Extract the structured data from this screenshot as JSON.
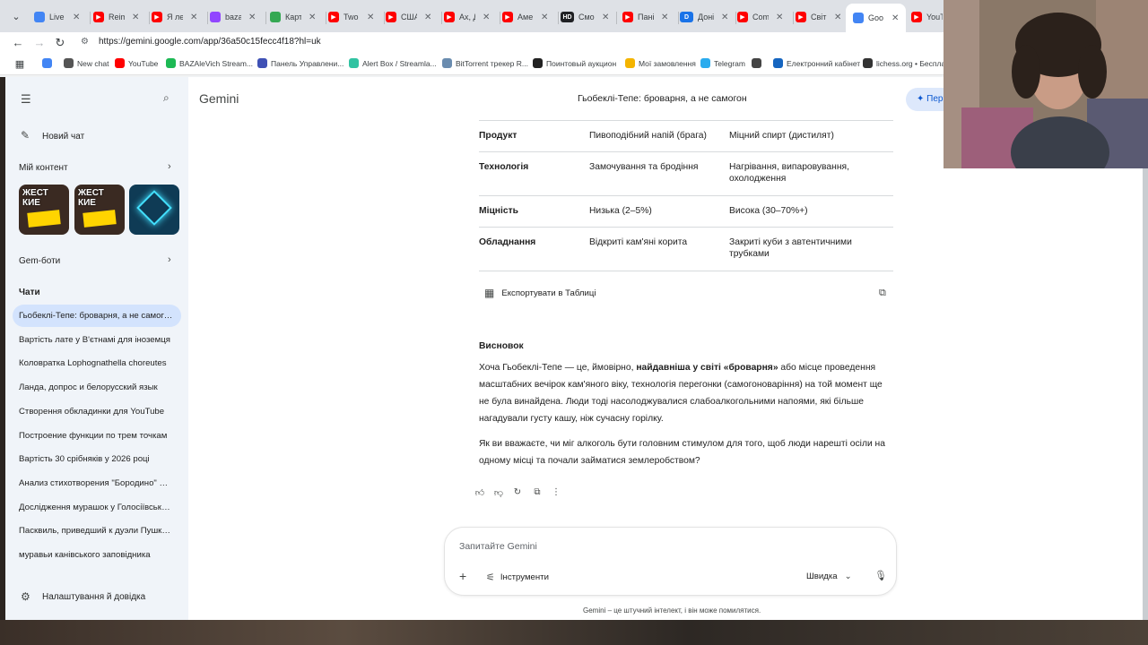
{
  "tabs": [
    {
      "title": "Live",
      "color": "#4285f4"
    },
    {
      "title": "Reim",
      "color": "#ff0000"
    },
    {
      "title": "Я ле",
      "color": "#ff0000"
    },
    {
      "title": "baza",
      "color": "#9146ff"
    },
    {
      "title": "Карт",
      "color": "#34a853"
    },
    {
      "title": "Two",
      "color": "#ff0000"
    },
    {
      "title": "США",
      "color": "#ff0000"
    },
    {
      "title": "Ах, Д",
      "color": "#ff0000"
    },
    {
      "title": "Аме",
      "color": "#ff0000"
    },
    {
      "title": "Смо",
      "color": "#202124",
      "badge": "HD"
    },
    {
      "title": "Пані",
      "color": "#ff0000"
    },
    {
      "title": "Доні",
      "color": "#1a73e8",
      "badge": "D"
    },
    {
      "title": "Com",
      "color": "#ff0000"
    },
    {
      "title": "Світ",
      "color": "#ff0000"
    },
    {
      "title": "Goo",
      "color": "#4285f4",
      "active": true
    },
    {
      "title": "YouT",
      "color": "#ff0000"
    }
  ],
  "address": {
    "url": "https://gemini.google.com/app/36a50c15fecc4f18?hl=uk"
  },
  "bookmarks": [
    {
      "label": "",
      "color": "#4285f4"
    },
    {
      "label": "New chat",
      "color": "#555555"
    },
    {
      "label": "YouTube",
      "color": "#ff0000"
    },
    {
      "label": "BAZAleVich Stream...",
      "color": "#1db954"
    },
    {
      "label": "Панель Управлени...",
      "color": "#3f51b5"
    },
    {
      "label": "Alert Box / Streamla...",
      "color": "#31c3a2"
    },
    {
      "label": "BitTorrent трекер R...",
      "color": "#6a8caf"
    },
    {
      "label": "Поинтовый аукцион",
      "color": "#222222"
    },
    {
      "label": "Мої замовлення",
      "color": "#f4b400"
    },
    {
      "label": "Telegram",
      "color": "#2aabee"
    },
    {
      "label": "",
      "color": "#444444"
    },
    {
      "label": "Електронний кабінет",
      "color": "#1565c0"
    },
    {
      "label": "lichess.org • Беспла...",
      "color": "#333333"
    }
  ],
  "sidebar": {
    "new_chat": "Новий чат",
    "my_content": "Мій контент",
    "gems": "Gem-боти",
    "chats_heading": "Чати",
    "settings": "Налаштування й довідка",
    "thumbs": [
      {
        "text": "ЖЕСТ КИЕ",
        "bg": "#3a2a22",
        "accent": "#ffd400"
      },
      {
        "text": "ЖЕСТ КИЕ",
        "bg": "#3a2a22",
        "accent": "#ffd400"
      },
      {
        "text": "",
        "bg": "#0f3b55",
        "accent": "#43e0ff"
      }
    ],
    "chats": [
      "Гьобеклі-Тепе: броварня, а не самогон",
      "Вартість лате у В'єтнамі для іноземця",
      "Коловратка Lophognathella choreutes",
      "Ланда, допрос и белорусский язык",
      "Створення обкладинки для YouTube",
      "Построение функции по трем точкам",
      "Вартість 30 срібняків у 2026 році",
      "Анализ стихотворения \"Бородино\" Лермонтова",
      "Дослідження мурашок у Голосіївському лісі",
      "Пасквиль, приведший к дуэли Пушкина",
      "муравьи канівського заповідника"
    ]
  },
  "header": {
    "brand": "Gemini",
    "chat_title": "Гьобеклі-Тепе: броварня, а не самогон",
    "upgrade": "Пер"
  },
  "table": {
    "rows": [
      {
        "label": "Продукт",
        "a": "Пивоподібний напій (брага)",
        "b": "Міцний спирт (дистилят)"
      },
      {
        "label": "Технологія",
        "a": "Замочування та бродіння",
        "b": "Нагрівання, випаровування,\nохолодження"
      },
      {
        "label": "Міцність",
        "a": "Низька (2–5%)",
        "b": "Висока (30–70%+)"
      },
      {
        "label": "Обладнання",
        "a": "Відкриті кам'яні корита",
        "b": "Закриті куби з автентичними\nтрубками"
      }
    ],
    "export_label": "Експортувати в Таблиці"
  },
  "conclusion": {
    "heading": "Висновок",
    "p1_start": "Хоча Гьобеклі-Тепе — це, ймовірно, ",
    "p1_bold": "найдавніша у світі «броварня»",
    "p1_end": " або місце проведення масштабних вечірок кам'яного віку, технологія перегонки (самогоноваріння) на той момент ще не була винайдена. Люди тоді насолоджувалися слабоалкогольними напоями, які більше нагадували густу кашу, ніж сучасну горілку.",
    "p2": "Як ви вважаєте, чи міг алкоголь бути головним стимулом для того, щоб люди нарешті осіли на одному місці та почали займатися землеробством?"
  },
  "input": {
    "placeholder": "Запитайте Gemini",
    "tools": "Інструменти",
    "mode": "Швидка"
  },
  "disclaimer": "Gemini – це штучний інтелект, і він може помилятися."
}
